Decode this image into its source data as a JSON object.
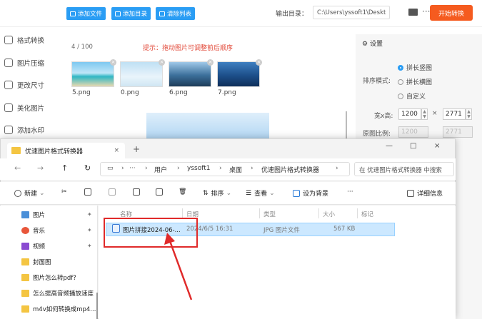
{
  "toolbar": {
    "add_files": "添加文件",
    "add_folder": "添加目录",
    "clear_list": "清除列表",
    "output_label": "输出目录：",
    "output_path": "C:\\Users\\yssoft1\\Deskt",
    "more": "···",
    "start": "开始转换"
  },
  "sidebar": {
    "items": [
      {
        "label": "格式转换",
        "icon": "convert-icon"
      },
      {
        "label": "图片压缩",
        "icon": "compress-icon"
      },
      {
        "label": "更改尺寸",
        "icon": "resize-icon"
      },
      {
        "label": "美化图片",
        "icon": "beautify-icon"
      },
      {
        "label": "添加水印",
        "icon": "watermark-icon"
      }
    ]
  },
  "content": {
    "count": "4 / 100",
    "hint": "提示：拖动图片可调整前后顺序",
    "images": [
      {
        "name": "5.png"
      },
      {
        "name": "0.png"
      },
      {
        "name": "6.png"
      },
      {
        "name": "7.png"
      }
    ]
  },
  "settings": {
    "header": "设置",
    "mode_label": "排序模式:",
    "options": [
      "拼长竖图",
      "拼长横图",
      "自定义"
    ],
    "size_label": "宽x高:",
    "width": "1200",
    "height": "2771",
    "ratio_label": "原图比例:",
    "ratio_w": "1200",
    "ratio_h": "2771"
  },
  "explorer": {
    "tab_title": "优速图片格式转换器",
    "tab_close": "×",
    "new_tab": "+",
    "window_controls": [
      "—",
      "□",
      "×"
    ],
    "breadcrumb": [
      "用户",
      "yssoft1",
      "桌面",
      "优速图片格式转换器"
    ],
    "search_placeholder": "在 优速图片格式转换器 中搜索",
    "tools": {
      "new": "新建",
      "sort": "排序",
      "view": "查看",
      "set_background": "设为背景",
      "more": "···",
      "details": "详细信息"
    },
    "nav_items": [
      {
        "label": "图片",
        "color": "#4a8fd8",
        "pinned": true
      },
      {
        "label": "音乐",
        "color": "#e8563a",
        "pinned": true
      },
      {
        "label": "视频",
        "color": "#8a4bd1",
        "pinned": true
      },
      {
        "label": "封面图",
        "color": "#f4c542",
        "pinned": false
      },
      {
        "label": "图片怎么转pdf?",
        "color": "#f4c542",
        "pinned": false
      },
      {
        "label": "怎么提高音频播放速度",
        "color": "#f4c542",
        "pinned": false
      },
      {
        "label": "m4v如何转换成mp4...",
        "color": "#f4c542",
        "pinned": false
      }
    ],
    "columns": [
      "名称",
      "日期",
      "类型",
      "大小",
      "标记"
    ],
    "files": [
      {
        "name": "图片拼接2024-06-...",
        "date": "2024/6/5 16:31",
        "type": "JPG 图片文件",
        "size": "567 KB",
        "tag": ""
      }
    ]
  }
}
